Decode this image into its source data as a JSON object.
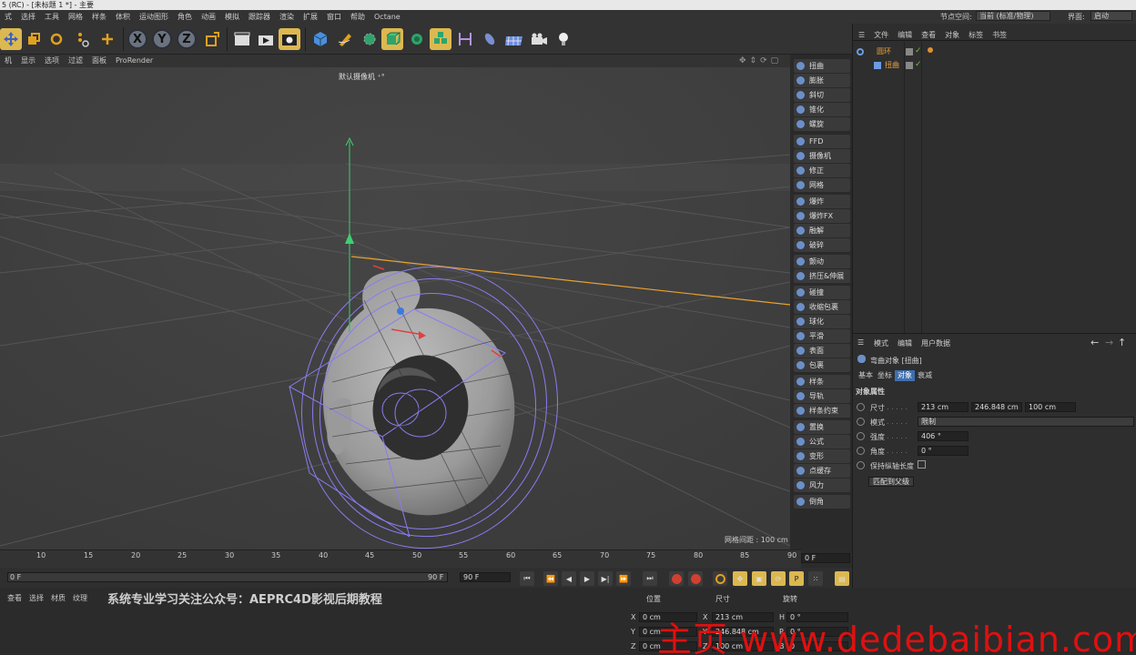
{
  "window": {
    "title": "5 (RC) - [未标题 1 *] - 主要"
  },
  "menubar": {
    "items": [
      "式",
      "选择",
      "工具",
      "网格",
      "样条",
      "体积",
      "运动图形",
      "角色",
      "动画",
      "模拟",
      "跟踪器",
      "渲染",
      "扩展",
      "窗口",
      "帮助",
      "Octane"
    ],
    "node_space_label": "节点空间:",
    "node_space_value": "当前 (标准/物理)",
    "layout_label": "界面:",
    "layout_value": "启动"
  },
  "toolbar": {
    "axis_x": "X",
    "axis_y": "Y",
    "axis_z": "Z"
  },
  "viewport": {
    "menu": [
      "机",
      "显示",
      "选项",
      "过滤",
      "面板",
      "ProRender"
    ],
    "camera_label": "默认摄像机 ⁺°",
    "grid_spacing": "网格间距 : 100 cm"
  },
  "deformers": [
    "扭曲",
    "膨胀",
    "斜切",
    "锥化",
    "螺旋",
    "FFD",
    "摄像机",
    "修正",
    "网格",
    "爆炸",
    "爆炸FX",
    "融解",
    "破碎",
    "颤动",
    "挤压&伸展",
    "碰撞",
    "收缩包裹",
    "球化",
    "平滑",
    "表面",
    "包裹",
    "样条",
    "导轨",
    "样条约束",
    "置换",
    "公式",
    "变形",
    "点缓存",
    "风力",
    "倒角"
  ],
  "object_manager": {
    "menu": [
      "文件",
      "编辑",
      "查看",
      "对象",
      "标签",
      "书签"
    ],
    "objects": [
      {
        "name": "圆环"
      },
      {
        "name": "扭曲"
      }
    ]
  },
  "attribute_manager": {
    "menu": [
      "模式",
      "编辑",
      "用户数据"
    ],
    "object_title": "弯曲对象 [扭曲]",
    "tabs": [
      "基本",
      "坐标",
      "对象",
      "衰减"
    ],
    "active_tab": "对象",
    "section": "对象属性",
    "size_label": "尺寸",
    "size_values": [
      "213 cm",
      "246.848 cm",
      "100 cm"
    ],
    "mode_label": "模式",
    "mode_value": "限制",
    "strength_label": "强度",
    "strength_value": "406 °",
    "angle_label": "角度",
    "angle_value": "0 °",
    "keep_length_label": "保持纵轴长度",
    "fit_parent_button": "匹配到父级"
  },
  "timeline": {
    "ticks": [
      "10",
      "15",
      "20",
      "25",
      "30",
      "35",
      "40",
      "45",
      "50",
      "55",
      "60",
      "65",
      "70",
      "75",
      "80",
      "85",
      "90"
    ],
    "current_frame": "0 F",
    "start_frame": "0 F",
    "end_frame": "90 F",
    "end_frame2": "90 F"
  },
  "bottom": {
    "menu": [
      "查看",
      "选择",
      "材质",
      "纹理"
    ],
    "banner": "系统专业学习关注公众号：AEPRC4D影视后期教程"
  },
  "coords": {
    "headers": [
      "位置",
      "尺寸",
      "旋转"
    ],
    "rows": [
      {
        "axis": "X",
        "pos": "0 cm",
        "size_axis": "X",
        "size": "213 cm",
        "rot_axis": "H",
        "rot": "0 °"
      },
      {
        "axis": "Y",
        "pos": "0 cm",
        "size_axis": "Y",
        "size": "246.848 cm",
        "rot_axis": "P",
        "rot": "0 °"
      },
      {
        "axis": "Z",
        "pos": "0 cm",
        "size_axis": "Z",
        "size": "100 cm",
        "rot_axis": "B",
        "rot": "0"
      }
    ]
  },
  "watermark": "主页 www.dedebaibian.com",
  "colors": {
    "accent": "#dcb850",
    "active_tab": "#3f6fae",
    "object_name": "#e8a040",
    "watermark": "#e01010"
  }
}
